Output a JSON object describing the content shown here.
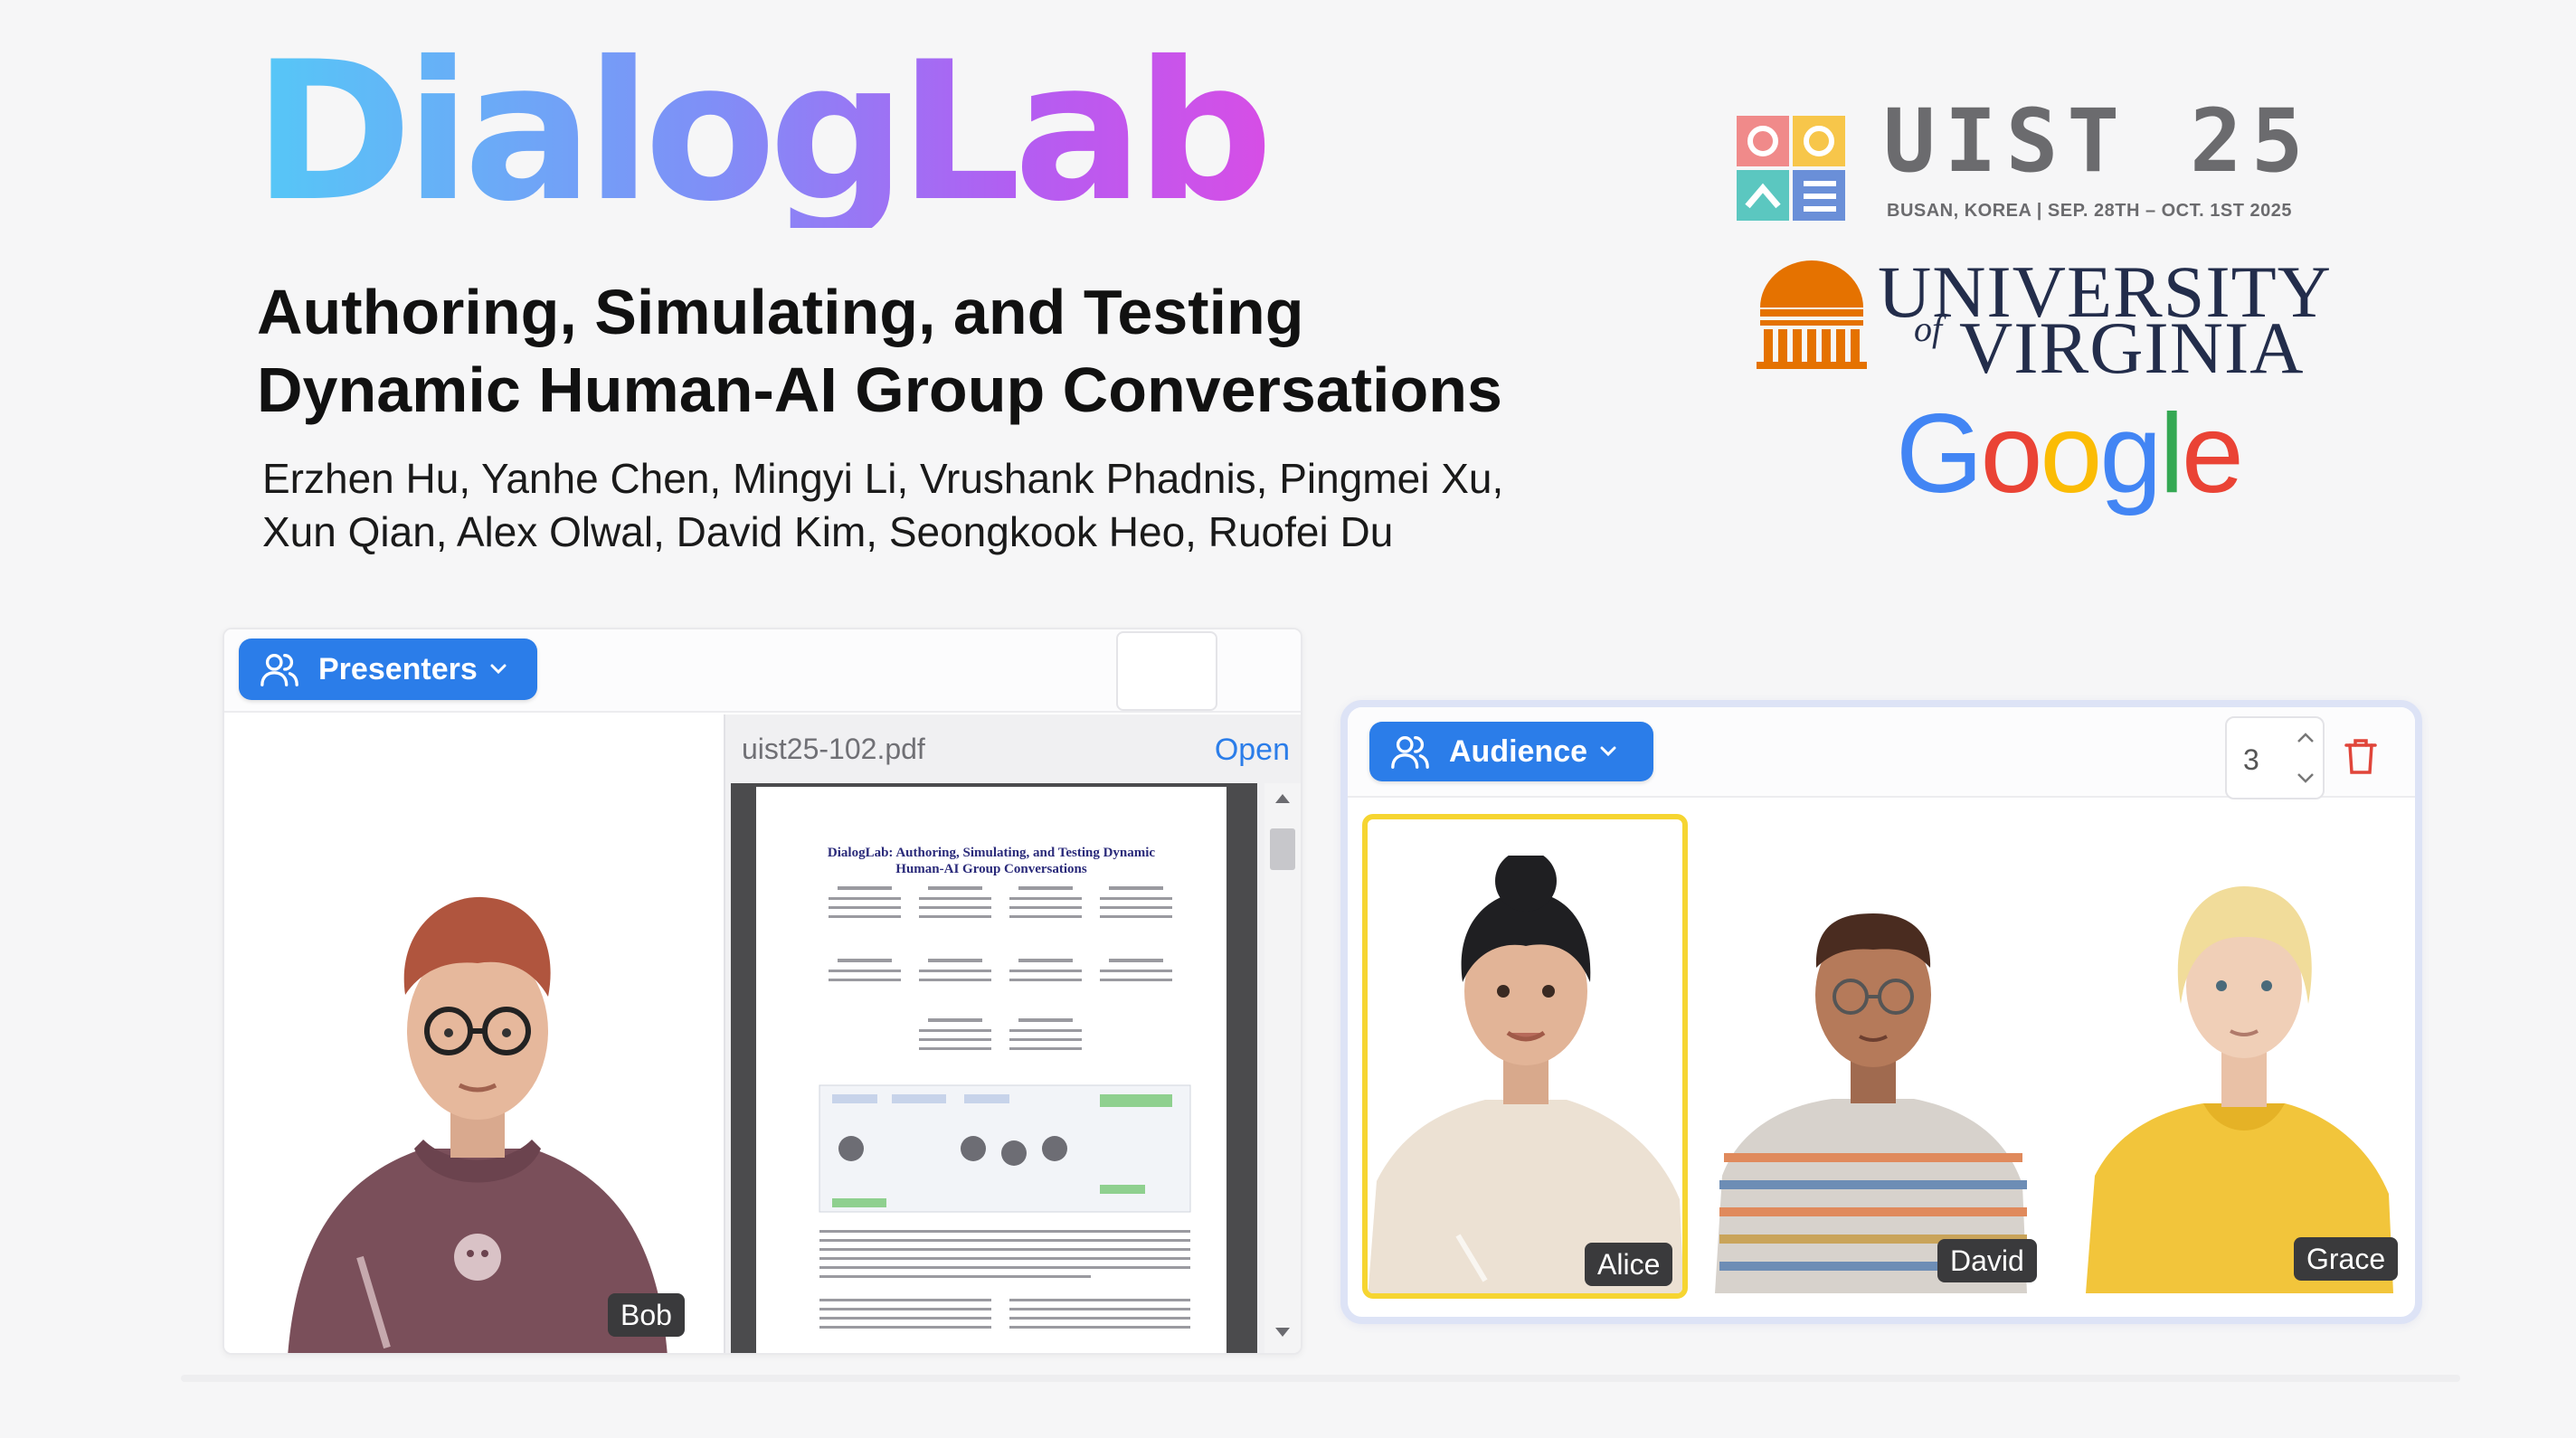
{
  "title": {
    "brand": "DialogLab",
    "subtitle_line1": "Authoring, Simulating, and Testing",
    "subtitle_line2": "Dynamic Human-AI Group Conversations",
    "authors_line1": "Erzhen Hu, Yanhe Chen, Mingyi Li, Vrushank Phadnis, Pingmei Xu,",
    "authors_line2": "Xun Qian, Alex Olwal, David Kim, Seongkook Heo, Ruofei Du"
  },
  "logos": {
    "uist_word": "UIST 25",
    "uist_sub": "BUSAN, KOREA | SEP. 28TH – OCT. 1ST 2025",
    "uva_line1": "UNIVERSITY",
    "uva_of": "of",
    "uva_line2": "VIRGINIA",
    "google": [
      "G",
      "o",
      "o",
      "g",
      "l",
      "e"
    ],
    "google_colors": [
      "#4285F4",
      "#EA4335",
      "#FBBC05",
      "#4285F4",
      "#34A853",
      "#EA4335"
    ]
  },
  "presenters": {
    "button_label": "Presenters",
    "avatar_name": "Bob",
    "pdf_filename": "uist25-102.pdf",
    "pdf_open_label": "Open",
    "pdf_title": "DialogLab: Authoring, Simulating, and Testing Dynamic Human-AI Group Conversations"
  },
  "audience": {
    "button_label": "Audience",
    "count": "3",
    "members": [
      {
        "name": "Alice",
        "selected": true
      },
      {
        "name": "David",
        "selected": false
      },
      {
        "name": "Grace",
        "selected": false
      }
    ]
  },
  "colors": {
    "accent": "#2b7de9",
    "selected": "#f6d531"
  }
}
